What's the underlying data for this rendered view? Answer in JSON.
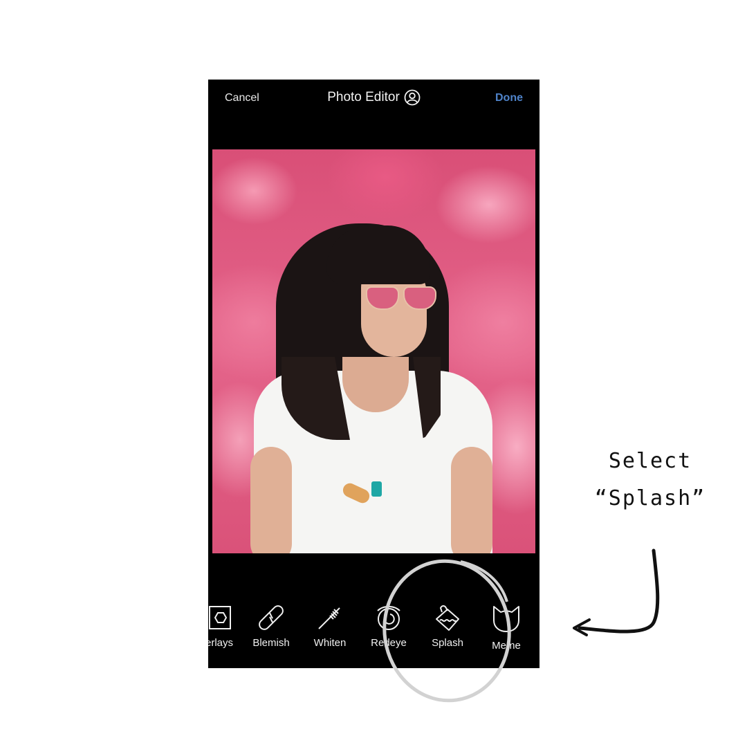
{
  "header": {
    "cancel_label": "Cancel",
    "title": "Photo Editor",
    "title_icon": "user-circle-icon",
    "done_label": "Done",
    "done_color": "#4f83c9"
  },
  "photo": {
    "description": "Woman with dark hair and pink aviator sunglasses in front of pink azalea flowers"
  },
  "toolbar": {
    "tools": [
      {
        "label": "erlays",
        "icon": "overlays-icon"
      },
      {
        "label": "Blemish",
        "icon": "bandage-icon"
      },
      {
        "label": "Whiten",
        "icon": "toothbrush-icon"
      },
      {
        "label": "Redeye",
        "icon": "eye-icon"
      },
      {
        "label": "Splash",
        "icon": "paint-bucket-icon"
      },
      {
        "label": "Meme",
        "icon": "cat-face-icon"
      }
    ],
    "highlighted": "Splash"
  },
  "annotation": {
    "line1": "Select",
    "line2": "“Splash”"
  }
}
